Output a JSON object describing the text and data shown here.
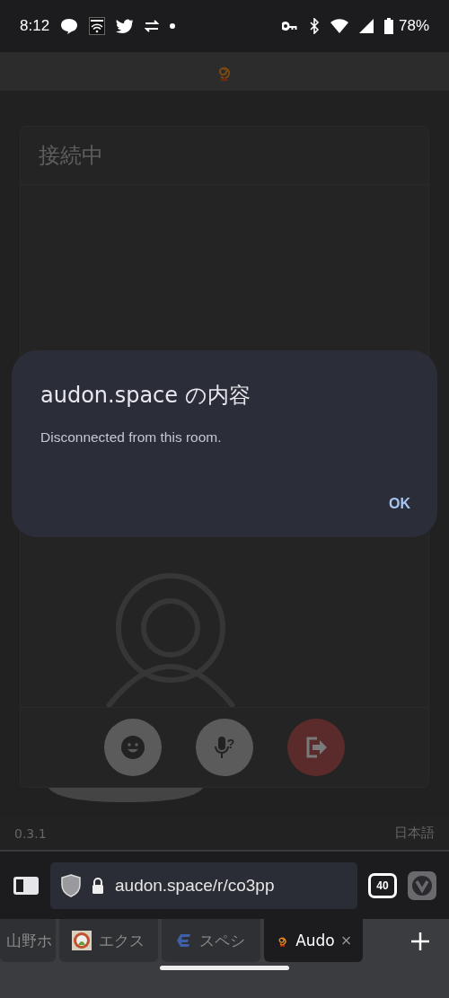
{
  "status_bar": {
    "time": "8:12",
    "battery": "78%"
  },
  "app": {
    "card": {
      "title": "接続中"
    },
    "controls": [
      {
        "kind": "reaction"
      },
      {
        "kind": "mic",
        "badge": "?"
      },
      {
        "kind": "leave"
      }
    ],
    "footer": {
      "version": "0.3.1",
      "language": "日本語"
    }
  },
  "dialog": {
    "title": "audon.space の内容",
    "message": "Disconnected from this room.",
    "button": "OK"
  },
  "browser": {
    "url": "audon.space/r/co3pp",
    "tab_count": "40",
    "tabs": [
      {
        "label": "山野ホ",
        "selected": false,
        "kind": "none"
      },
      {
        "label": "エクス",
        "selected": false,
        "kind": "badge"
      },
      {
        "label": "スペシ",
        "selected": false,
        "kind": "letter"
      },
      {
        "label": "Audo",
        "selected": true,
        "kind": "spiral"
      }
    ]
  }
}
